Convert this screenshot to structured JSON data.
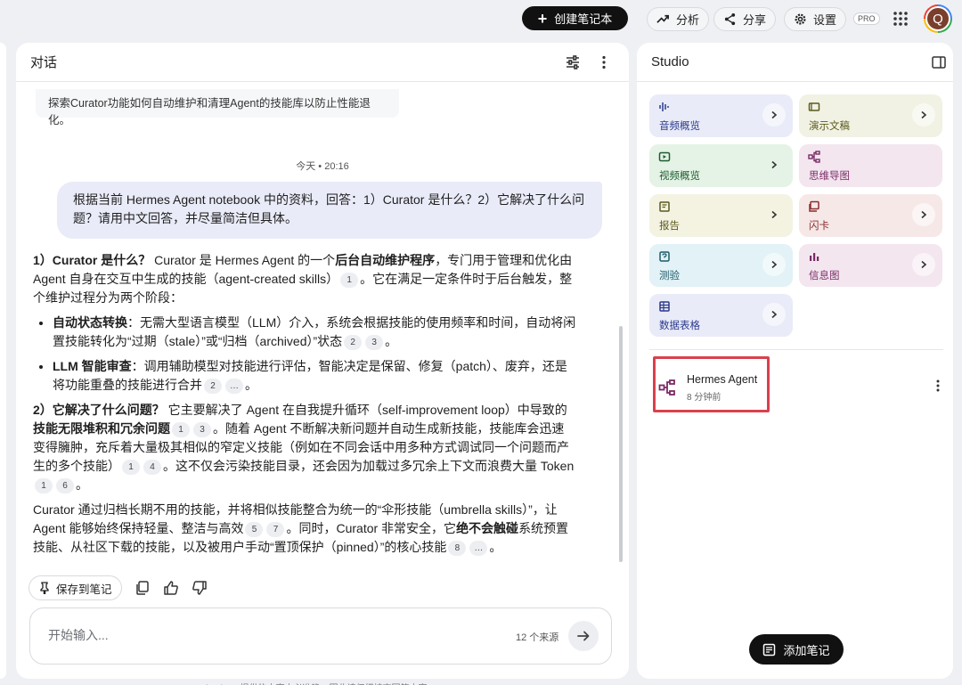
{
  "topbar": {
    "create_label": "创建笔记本",
    "analyze_label": "分析",
    "share_label": "分享",
    "settings_label": "设置",
    "pro_badge": "PRO",
    "avatar_initial": "Q"
  },
  "chat": {
    "title": "对话",
    "prev_message": "探索Curator功能如何自动维护和清理Agent的技能库以防止性能退化。",
    "timestamp": "今天 • 20:16",
    "user_message": "根据当前 Hermes Agent notebook 中的资料，回答：1）Curator 是什么？2）它解决了什么问题？请用中文回答，并尽量简洁但具体。",
    "answer": {
      "p1": {
        "b1": "1）Curator 是什么？",
        "t1": " Curator 是 Hermes Agent 的一个",
        "b2": "后台自动维护程序",
        "t2": "，专门用于管理和优化由 Agent 自身在交互中生成的技能（agent-created skills）",
        "c1": "1",
        "t3": "。它在满足一定条件时于后台触发，整个维护过程分为两个阶段："
      },
      "li1": {
        "b": "自动状态转换",
        "t1": "：无需大型语言模型（LLM）介入，系统会根据技能的使用频率和时间，自动将闲置技能转化为“过期（stale）”或“归档（archived）”状态",
        "c1": "2",
        "c2": "3",
        "t2": "。"
      },
      "li2": {
        "b": "LLM 智能审查",
        "t1": "：调用辅助模型对技能进行评估，智能决定是保留、修复（patch）、废弃，还是将功能重叠的技能进行合并",
        "c1": "2",
        "c2": "…",
        "t2": "。"
      },
      "p2": {
        "b1": "2）它解决了什么问题？",
        "t1": " 它主要解决了 Agent 在自我提升循环（self-improvement loop）中导致的",
        "b2": "技能无限堆积和冗余问题",
        "c1": "1",
        "c2": "3",
        "t2": "。随着 Agent 不断解决新问题并自动生成新技能，技能库会迅速变得臃肿，充斥着大量极其相似的窄定义技能（例如在不同会话中用多种方式调试同一个问题而产生的多个技能）",
        "c3": "1",
        "c4": "4",
        "t3": "。这不仅会污染技能目录，还会因为加载过多冗余上下文而浪费大量 Token",
        "c5": "1",
        "c6": "6",
        "t4": "。"
      },
      "p3": {
        "t1": "Curator 通过归档长期不用的技能，并将相似技能整合为统一的“伞形技能（umbrella skills）”，让 Agent 能够始终保持轻量、整洁与高效",
        "c1": "5",
        "c2": "7",
        "t2": "。同时，Curator 非常安全，它",
        "b1": "绝不会触碰",
        "t3": "系统预置技能、从社区下载的技能，以及被用户手动“置顶保护（pinned）”的核心技能",
        "c3": "8",
        "c4": "…",
        "t4": "。"
      }
    },
    "save_note_label": "保存到笔记",
    "input_placeholder": "开始输入...",
    "source_count": "12 个来源",
    "footnote": "NotebookLM 提供的内容未必准确，因此请仔细核查回答内容。"
  },
  "studio": {
    "title": "Studio",
    "tiles": [
      {
        "label": "音频概览",
        "icon": "audio-wave-icon",
        "bg": "#e9ebf8",
        "fg": "#2b3a8c"
      },
      {
        "label": "演示文稿",
        "icon": "slides-icon",
        "bg": "#f1f2e4",
        "fg": "#5b5a1e"
      },
      {
        "label": "视频概览",
        "icon": "video-icon",
        "bg": "#e4f3e6",
        "fg": "#1d5c2e"
      },
      {
        "label": "思维导图",
        "icon": "mind-map-icon",
        "bg": "#f3e6ef",
        "fg": "#7a2b66"
      },
      {
        "label": "报告",
        "icon": "report-icon",
        "bg": "#f4f3e2",
        "fg": "#5b5a1e"
      },
      {
        "label": "闪卡",
        "icon": "flashcard-icon",
        "bg": "#f7e8e8",
        "fg": "#8a2e2e"
      },
      {
        "label": "测验",
        "icon": "quiz-icon",
        "bg": "#e2f2f6",
        "fg": "#1d5a6a"
      },
      {
        "label": "信息图",
        "icon": "infographic-icon",
        "bg": "#f3e6ef",
        "fg": "#7a2b66"
      },
      {
        "label": "数据表格",
        "icon": "table-icon",
        "bg": "#e9ebf8",
        "fg": "#2b3a8c"
      }
    ],
    "note": {
      "title": "Hermes Agent",
      "subtitle": "8 分钟前"
    },
    "add_note_label": "添加笔记",
    "highlight_color": "#d9414d"
  }
}
